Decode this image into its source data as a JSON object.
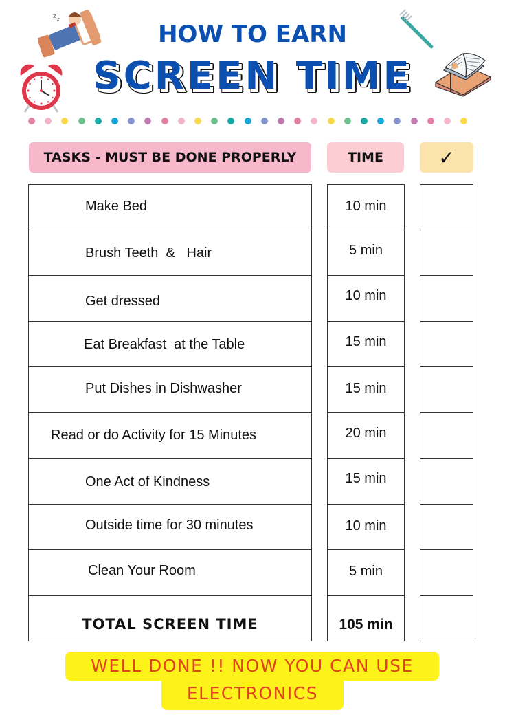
{
  "header": {
    "subtitle": "HOW TO EARN",
    "title": "SCREEN TIME"
  },
  "decorations": {
    "icons": [
      "sleeping-child-in-bed-icon",
      "alarm-clock-icon",
      "toothbrush-icon",
      "books-icon"
    ],
    "dot_colors": [
      "#e47fa8",
      "#f4b6c8",
      "#fad94a",
      "#6cbf8c",
      "#17a8a3",
      "#14a6d9",
      "#8593cf",
      "#c07bb3",
      "#e47fa8",
      "#f4b6c8",
      "#fad94a",
      "#6cbf8c",
      "#17a8a3",
      "#14a6d9",
      "#8593cf",
      "#c07bb3",
      "#e47fa8",
      "#f4b6c8",
      "#fad94a",
      "#6cbf8c",
      "#17a8a3",
      "#14a6d9",
      "#8593cf",
      "#c07bb3",
      "#e47fa8",
      "#f4b6c8",
      "#fad94a"
    ]
  },
  "table": {
    "headers": {
      "tasks": "TASKS - MUST BE DONE PROPERLY",
      "time": "TIME",
      "check": "✓"
    },
    "rows": [
      {
        "task": "Make Bed",
        "time": "10 min",
        "done": false
      },
      {
        "task": "Brush Teeth  &   Hair",
        "time": "5 min",
        "done": false
      },
      {
        "task": "Get dressed",
        "time": "10 min",
        "done": false
      },
      {
        "task": "Eat Breakfast  at the Table",
        "time": "15 min",
        "done": false
      },
      {
        "task": "Put Dishes in Dishwasher",
        "time": "15 min",
        "done": false
      },
      {
        "task": "Read or do Activity for 15 Minutes",
        "time": "20 min",
        "done": false
      },
      {
        "task": "One Act of Kindness",
        "time": "15 min",
        "done": false
      },
      {
        "task": "Outside time for 30 minutes",
        "time": "10 min",
        "done": false
      },
      {
        "task": "Clean Your Room",
        "time": "5 min",
        "done": false
      }
    ],
    "total": {
      "label": "TOTAL SCREEN TIME",
      "time": "105 min"
    }
  },
  "footer": {
    "line1": "WELL DONE !! NOW YOU CAN USE",
    "line2": "ELECTRONICS"
  },
  "colors": {
    "title_blue": "#0b4fb0",
    "tasks_header_bg": "#f7b8cc",
    "time_header_bg": "#fccdd2",
    "check_header_bg": "#fbe3ab",
    "banner_bg": "#fdf21a",
    "banner_text": "#e0431d"
  }
}
